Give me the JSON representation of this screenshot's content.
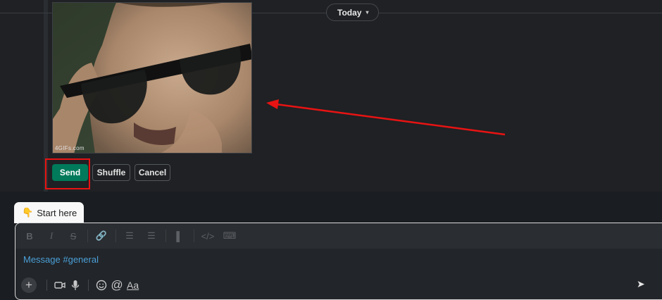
{
  "divider": {
    "label": "Today"
  },
  "gif": {
    "credit": "4GIFs.com"
  },
  "actions": {
    "send_label": "Send",
    "shuffle_label": "Shuffle",
    "cancel_label": "Cancel"
  },
  "composer": {
    "start_tab_label": "Start here",
    "start_tab_emoji": "👇",
    "placeholder": "Message #general",
    "format_toolbar": [
      "bold-icon",
      "italic-icon",
      "strikethrough-icon",
      "link-icon",
      "ordered-list-icon",
      "bullet-list-icon",
      "blockquote-icon",
      "code-icon",
      "code-block-icon"
    ],
    "aa_label": "Aa"
  },
  "colors": {
    "send": "#007a5a",
    "annotation": "#e81313",
    "link": "#4a9fd8"
  }
}
